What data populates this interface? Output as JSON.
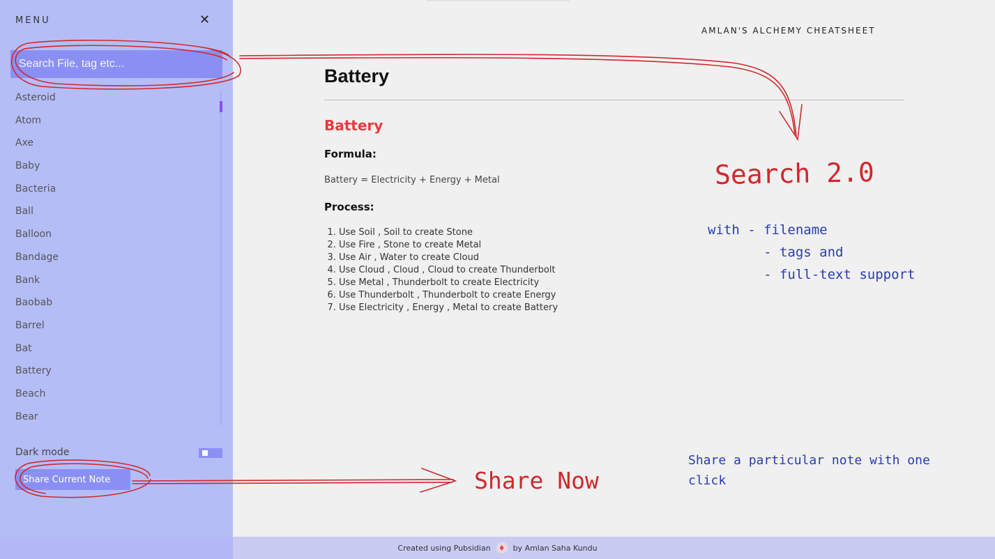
{
  "sidebar": {
    "menu_title": "MENU",
    "close_glyph": "✕",
    "search_placeholder": "Search File, tag etc...",
    "files": [
      "Asteroid",
      "Atom",
      "Axe",
      "Baby",
      "Bacteria",
      "Ball",
      "Balloon",
      "Bandage",
      "Bank",
      "Baobab",
      "Barrel",
      "Bat",
      "Battery",
      "Beach",
      "Bear"
    ],
    "dark_mode_label": "Dark mode",
    "share_button": "Share Current Note"
  },
  "header": {
    "site_title": "AMLAN'S ALCHEMY CHEATSHEET"
  },
  "note": {
    "title": "Battery",
    "heading": "Battery",
    "formula_label": "Formula:",
    "formula": "Battery = Electricity + Energy + Metal",
    "process_label": "Process:",
    "steps": [
      "Use Soil , Soil to create Stone",
      "Use Fire , Stone to create Metal",
      "Use Air , Water to create Cloud",
      "Use Cloud , Cloud , Cloud to create Thunderbolt",
      "Use Metal , Thunderbolt to create Electricity",
      "Use Thunderbolt , Thunderbolt to create Energy",
      "Use Electricity , Energy , Metal to create Battery"
    ]
  },
  "annotations": {
    "search_title": "Search 2.0",
    "search_features": "with - filename\n       - tags and\n       - full-text support",
    "share_title": "Share Now",
    "share_desc": "Share a particular note with one click"
  },
  "footer": {
    "created_text": "Created using Pubsidian",
    "author_text": "by Amlan Saha Kundu"
  },
  "colors": {
    "sidebar_bg": "#b5bdf7",
    "accent": "#8a90f3",
    "heading_red": "#e8393d",
    "annotation_red": "#d0282c",
    "annotation_blue": "#2a3bb5"
  },
  "icons": {
    "close": "close-icon",
    "logo": "pubsidian-logo-icon"
  }
}
